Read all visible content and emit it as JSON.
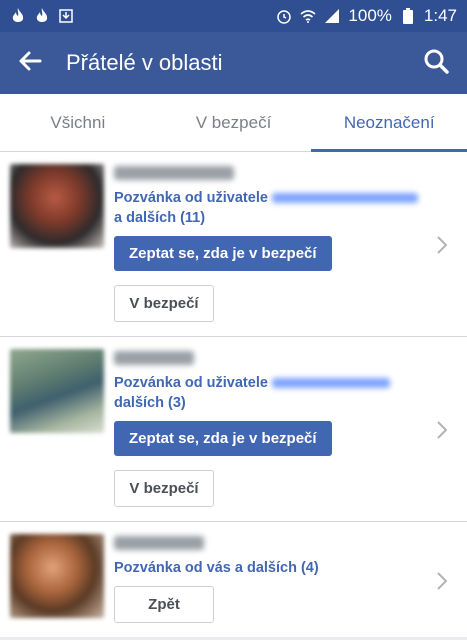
{
  "status": {
    "left_icons": [
      "tinder-flame-icon",
      "tinder-flame-icon",
      "download-icon"
    ],
    "battery": "100%",
    "time": "1:47"
  },
  "header": {
    "title": "Přátelé v oblasti"
  },
  "tabs": [
    {
      "label": "Všichni"
    },
    {
      "label": "V bezpečí"
    },
    {
      "label": "Neoznačení"
    }
  ],
  "rows": [
    {
      "invite_prefix": "Pozvánka od uživatele",
      "invite_suffix": "a dalších (11)",
      "primary_label": "Zeptat se, zda je v bezpečí",
      "secondary_label": "V bezpečí"
    },
    {
      "invite_prefix": "Pozvánka od uživatele",
      "invite_suffix": "dalších (3)",
      "primary_label": "Zeptat se, zda je v bezpečí",
      "secondary_label": "V bezpečí"
    },
    {
      "invite_text": "Pozvánka od vás a dalších (4)",
      "secondary_label": "Zpět"
    }
  ]
}
